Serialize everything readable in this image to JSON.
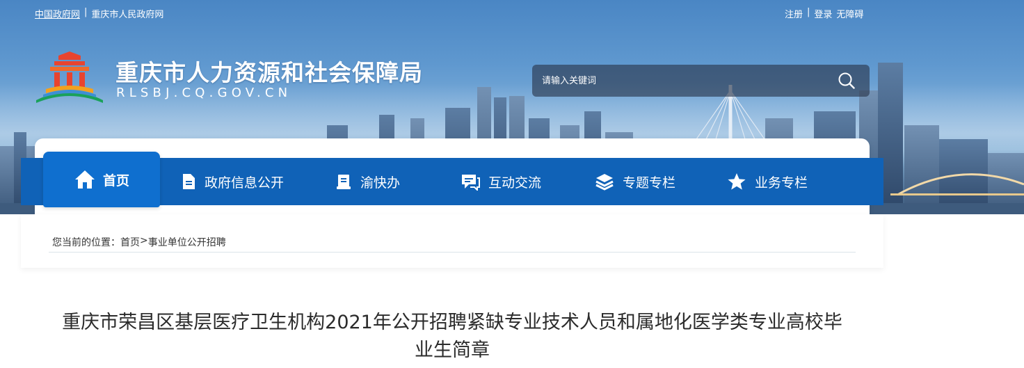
{
  "top_links": {
    "left": [
      "中国政府网",
      "重庆市人民政府网"
    ],
    "separator": "|",
    "right": [
      "注册",
      "登录",
      "无障碍"
    ]
  },
  "header": {
    "title": "重庆市人力资源和社会保障局",
    "domain": "RLSBJ.CQ.GOV.CN"
  },
  "search": {
    "placeholder": "请输入关键词",
    "icon": "search-icon"
  },
  "nav": {
    "items": [
      {
        "label": "首页",
        "icon": "home-icon",
        "active": true
      },
      {
        "label": "政府信息公开",
        "icon": "document-icon"
      },
      {
        "label": "渝快办",
        "icon": "clipboard-icon"
      },
      {
        "label": "互动交流",
        "icon": "chat-icon"
      },
      {
        "label": "专题专栏",
        "icon": "layers-icon"
      },
      {
        "label": "业务专栏",
        "icon": "star-icon"
      }
    ]
  },
  "breadcrumb": {
    "prefix": "您当前的位置：",
    "home": "首页",
    "separator": ">",
    "current": "事业单位公开招聘"
  },
  "article": {
    "title": "重庆市荣昌区基层医疗卫生机构2021年公开招聘紧缺专业技术人员和属地化医学类专业高校毕业生简章"
  },
  "colors": {
    "nav_bg": "#1062b7",
    "nav_active": "#0f6fcf",
    "text": "#2b2b2b"
  }
}
